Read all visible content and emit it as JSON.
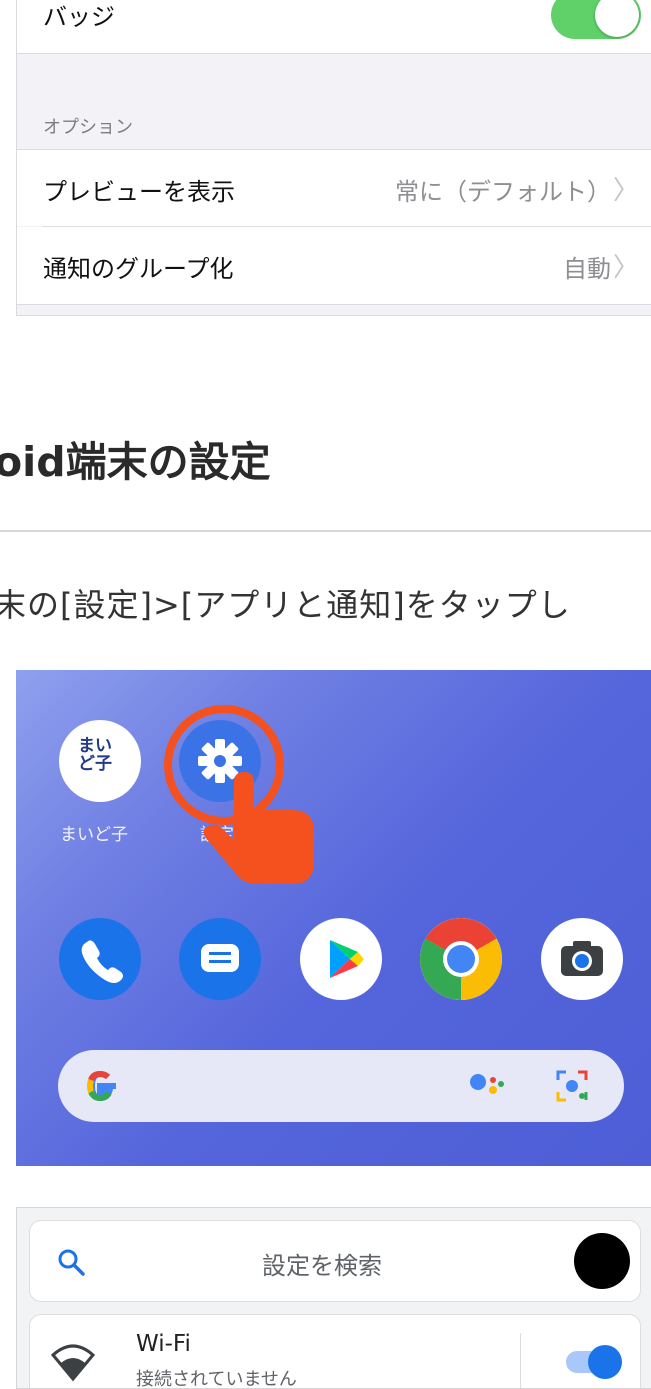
{
  "ios_settings": {
    "badge_label": "バッジ",
    "badge_toggle_on": true,
    "options_header": "オプション",
    "preview_label": "プレビューを表示",
    "preview_value": "常に（デフォルト）",
    "grouping_label": "通知のグループ化",
    "grouping_value": "自動",
    "chevron": "〉"
  },
  "article": {
    "heading": "oid端末の設定",
    "instruction": "末の[設定]>[アプリと通知]をタップし"
  },
  "home_screen": {
    "apps": [
      {
        "icon": "maidoko-app-icon",
        "label": "まいど子",
        "logo_text": "まい\nど子"
      },
      {
        "icon": "settings-gear-icon",
        "label": "設定"
      }
    ],
    "dock": [
      "phone-icon",
      "messages-icon",
      "play-store-icon",
      "chrome-icon",
      "camera-icon"
    ],
    "search_bar_icons": [
      "google-logo-icon",
      "assistant-icon",
      "lens-icon"
    ],
    "accent_color": "#f4511e"
  },
  "android_settings": {
    "search_placeholder": "設定を検索",
    "wifi_title": "Wi-Fi",
    "wifi_subtitle": "接続されていません",
    "wifi_toggle_on": true,
    "accent_color": "#1a73e8"
  }
}
